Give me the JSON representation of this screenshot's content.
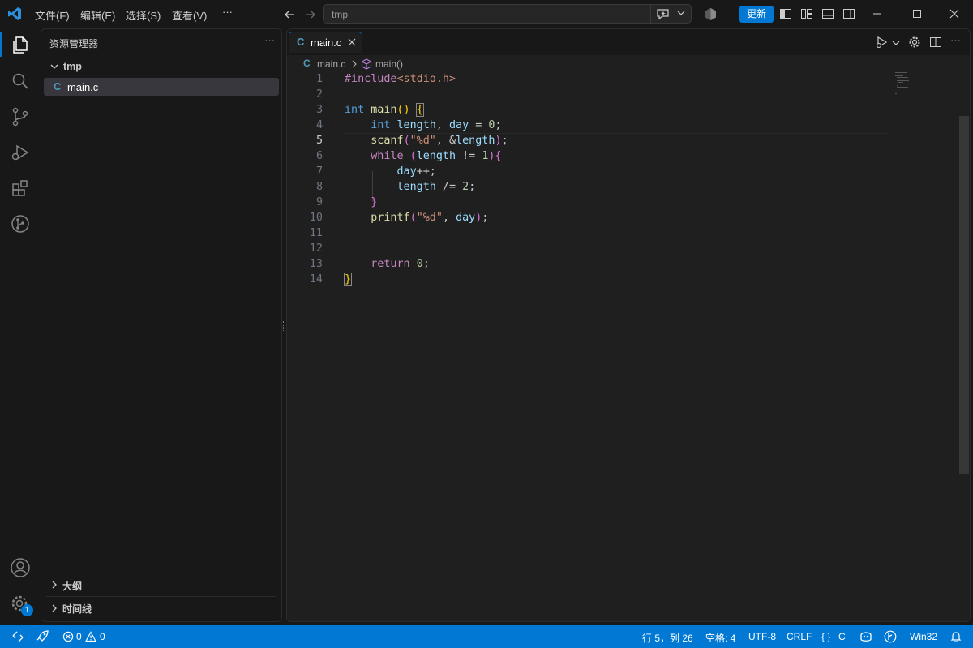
{
  "menu": {
    "file": "文件(F)",
    "edit": "编辑(E)",
    "selection": "选择(S)",
    "view": "查看(V)",
    "more": "···"
  },
  "command_center": {
    "text": "tmp"
  },
  "update_button": "更新",
  "notifications_badge": "1",
  "explorer": {
    "title": "资源管理器",
    "folder": "tmp",
    "file": "main.c",
    "file_icon": "C",
    "outline": "大纲",
    "timeline": "时间线"
  },
  "editor": {
    "tab_label": "main.c",
    "tab_icon": "C",
    "breadcrumb_file": "main.c",
    "breadcrumb_symbol": "main()",
    "line_numbers": [
      "1",
      "2",
      "3",
      "4",
      "5",
      "6",
      "7",
      "8",
      "9",
      "10",
      "11",
      "12",
      "13",
      "14"
    ]
  },
  "status": {
    "errors": "0",
    "warnings": "0",
    "position": "行 5，列 26",
    "spaces": "空格: 4",
    "encoding": "UTF-8",
    "eol": "CRLF",
    "language": "C",
    "platform": "Win32"
  },
  "colors": {
    "accent": "#0078d4",
    "background": "#181818",
    "editor_bg": "#1f1f1f",
    "keyword": "#569cd6",
    "string": "#ce9178",
    "number": "#b5cea8"
  }
}
